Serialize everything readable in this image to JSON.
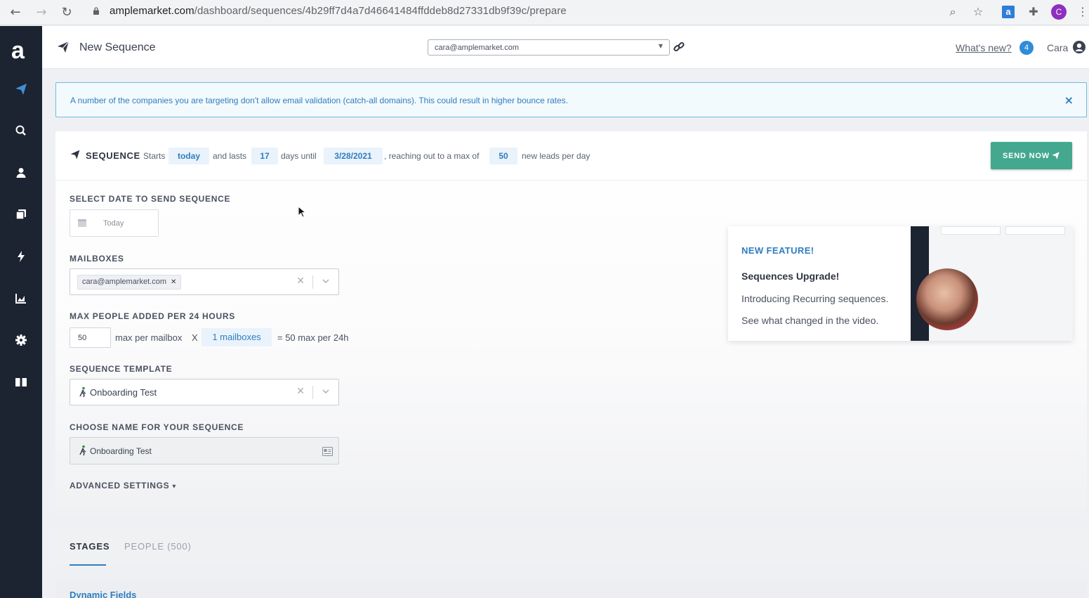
{
  "browser": {
    "url_host": "amplemarket.com",
    "url_path": "/dashboard/sequences/4b29ff7d4a7d46641484ffddeb8d27331db9f39c/prepare",
    "profile_initial": "C"
  },
  "header": {
    "title": "New Sequence",
    "account_select": "cara@amplemarket.com",
    "whats_new": "What's new?",
    "badge_count": "4",
    "user_name": "Cara"
  },
  "sidebar": {
    "logo": "a",
    "items": [
      "sequences",
      "search",
      "contacts",
      "templates",
      "automations",
      "analytics",
      "settings",
      "docs"
    ]
  },
  "alert": {
    "text": "A number of the companies you are targeting don't allow email validation (catch-all domains). This could result in higher bounce rates.",
    "close": "×"
  },
  "sequence": {
    "label": "SEQUENCE",
    "starts": "Starts",
    "start_value": "today",
    "and_lasts": "and lasts",
    "days_value": "17",
    "days_until": "days until",
    "end_date": "3/28/2021",
    "reaching": ", reaching out to a max of",
    "max_leads": "50",
    "per_day": "new leads per day",
    "send_now": "SEND NOW"
  },
  "form": {
    "date_label": "SELECT DATE TO SEND SEQUENCE",
    "date_value": "Today",
    "mailboxes_label": "MAILBOXES",
    "mailbox_tag": "cara@amplemarket.com",
    "max_label": "MAX PEOPLE ADDED PER 24 HOURS",
    "max_value": "50",
    "max_per_mailbox": "max per mailbox",
    "times": "X",
    "mailbox_count": "1 mailboxes",
    "equals_text": "= 50 max per 24h",
    "template_label": "SEQUENCE TEMPLATE",
    "template_value": "Onboarding Test",
    "name_label": "CHOOSE NAME FOR YOUR SEQUENCE",
    "name_value": "Onboarding Test",
    "advanced": "ADVANCED SETTINGS"
  },
  "feature": {
    "title": "NEW FEATURE!",
    "heading": "Sequences Upgrade!",
    "line1": "Introducing Recurring sequences.",
    "line2": "See what changed in the video."
  },
  "tabs": {
    "stages": "STAGES",
    "people": "PEOPLE (500)",
    "dynamic_fields": "Dynamic Fields"
  },
  "colors": {
    "sidebar": "#1c2331",
    "accent": "#2f7dbf",
    "send_button": "#43a88f"
  }
}
